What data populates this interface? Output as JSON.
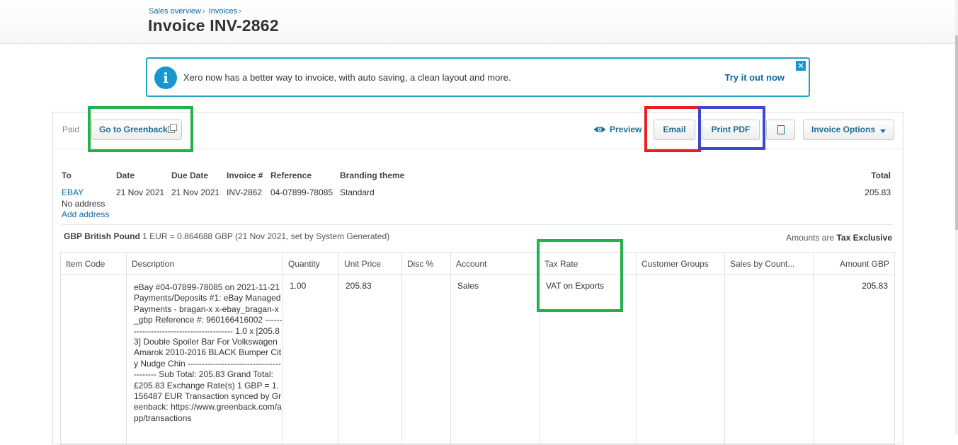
{
  "breadcrumb": {
    "items": [
      "Sales overview",
      "Invoices"
    ],
    "separator": "›"
  },
  "page_title": "Invoice INV-2862",
  "banner": {
    "icon": "info-icon",
    "message": "Xero now has a better way to invoice, with auto saving, a clean layout and more.",
    "cta": "Try it out now",
    "close": "✕"
  },
  "toolbar": {
    "status": "Paid",
    "greenback_label": "Go to Greenback",
    "preview_label": "Preview",
    "email_label": "Email",
    "print_pdf_label": "Print PDF",
    "copy_icon": "copy-icon",
    "invoice_options_label": "Invoice Options"
  },
  "invoice_meta": {
    "headers": {
      "to": "To",
      "date": "Date",
      "due_date": "Due Date",
      "invoice_number": "Invoice #",
      "reference": "Reference",
      "branding_theme": "Branding theme",
      "total": "Total"
    },
    "to": "EBAY",
    "no_address": "No address",
    "add_address": "Add address",
    "date": "21 Nov 2021",
    "due_date": "21 Nov 2021",
    "invoice_number": "INV-2862",
    "reference": "04-07899-78085",
    "branding_theme": "Standard",
    "total": "205.83"
  },
  "currency": {
    "name": "GBP British Pound",
    "rate_text": "1 EUR = 0.864688 GBP (21 Nov 2021, set by System Generated)",
    "amounts_prefix": "Amounts are",
    "amounts_mode": "Tax Exclusive"
  },
  "line_table": {
    "headers": [
      "Item Code",
      "Description",
      "Quantity",
      "Unit Price",
      "Disc %",
      "Account",
      "Tax Rate",
      "Customer Groups",
      "Sales by Count...",
      "Amount GBP"
    ],
    "rows": [
      {
        "item_code": "",
        "description": "eBay #04-07899-78085 on 2021-11-21 Payments/Deposits #1: eBay Managed Payments - bragan-x x-ebay_bragan-x_gbp Reference #: 960166416002 ----------------------------------------- 1.0 x [205.83] Double Spoiler Bar For Volkswagen Amarok 2010-2016 BLACK Bumper City Nudge Chin ----------------------------------------- Sub Total: 205.83 Grand Total: £205.83 Exchange Rate(s) 1 GBP = 1.156487 EUR Transaction synced by Greenback: https://www.greenback.com/app/transactions",
        "quantity": "1.00",
        "unit_price": "205.83",
        "disc": "",
        "account": "Sales",
        "tax_rate": "VAT on Exports",
        "customer_groups": "",
        "sales_by_country": "",
        "amount": "205.83"
      }
    ]
  },
  "highlight_colors": {
    "green": "#22b14c",
    "red": "#ed1c24",
    "blue": "#3f48cc"
  }
}
